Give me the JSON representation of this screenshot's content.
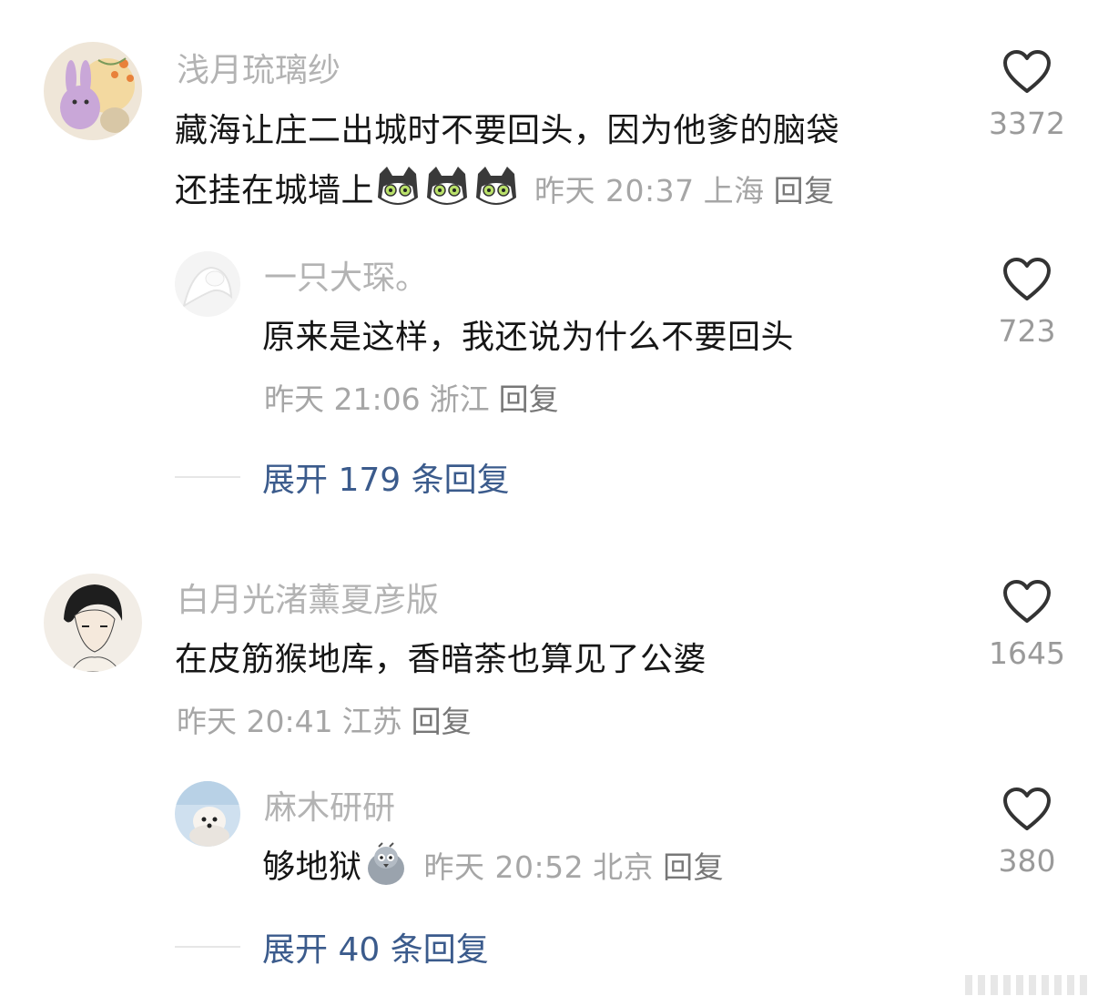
{
  "comments": [
    {
      "username": "浅月琉璃纱",
      "text_line1": "藏海让庄二出城时不要回头，因为他爹的脑袋",
      "text_line2": "还挂在城墙上",
      "emoji_count": 3,
      "emoji_icon": "cat-emoji-icon",
      "time": "昨天 20:37",
      "location": "上海",
      "reply": "回复",
      "likes": "3372",
      "replies": [
        {
          "username": "一只大琛。",
          "text": "原来是这样，我还说为什么不要回头",
          "time": "昨天 21:06",
          "location": "浙江",
          "reply": "回复",
          "likes": "723"
        }
      ],
      "expand_label": "展开 179 条回复"
    },
    {
      "username": "白月光渚薰夏彦版",
      "text": "在皮筋猴地库，香暗荼也算见了公婆",
      "time": "昨天 20:41",
      "location": "江苏",
      "reply": "回复",
      "likes": "1645",
      "replies": [
        {
          "username": "麻木研研",
          "text": "够地狱",
          "emoji_icon": "pigeon-emoji-icon",
          "time": "昨天 20:52",
          "location": "北京",
          "reply": "回复",
          "likes": "380"
        }
      ],
      "expand_label": "展开 40 条回复"
    }
  ],
  "colors": {
    "username": "#b3b3b3",
    "text": "#161616",
    "meta": "#a6a6a6",
    "link": "#3b5b8c"
  }
}
